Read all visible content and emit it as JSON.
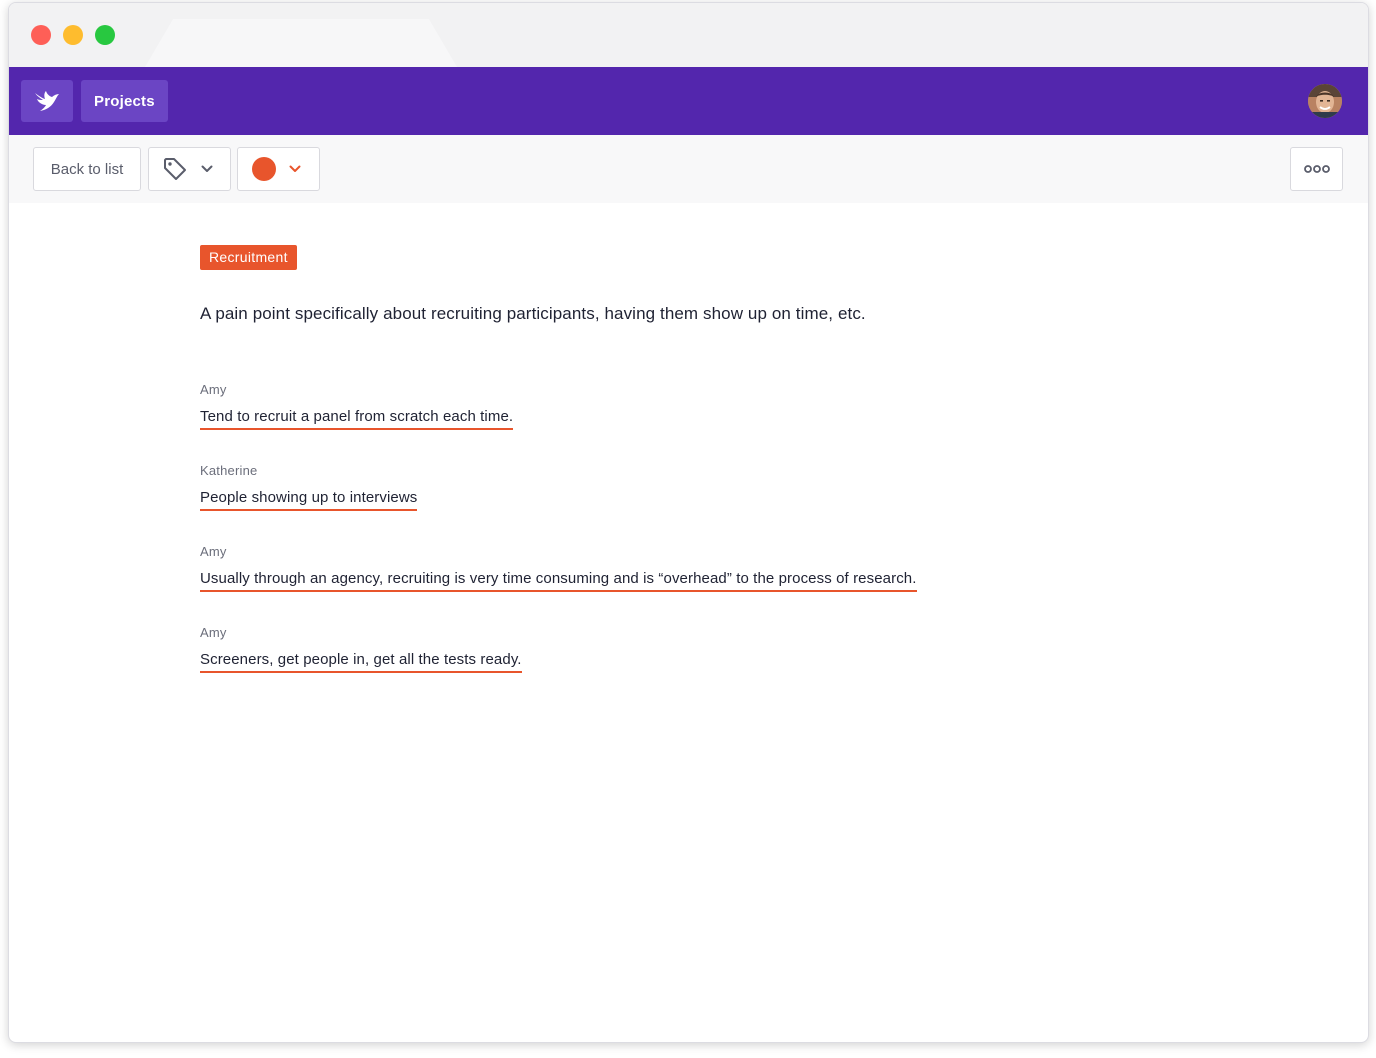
{
  "window": {
    "traffic_lights": [
      "close",
      "minimize",
      "maximize"
    ]
  },
  "appbar": {
    "logo_icon": "bird-logo-icon",
    "projects_label": "Projects",
    "avatar_icon": "user-avatar"
  },
  "toolbar": {
    "back_label": "Back to list",
    "tag_icon": "tag-icon",
    "color_value": "#e8552c",
    "more_icon": "more-dots-icon"
  },
  "insight": {
    "tag": "Recruitment",
    "description": "A pain point specifically about recruiting participants, having them show up on time, etc.",
    "quotes": [
      {
        "author": "Amy",
        "text": "Tend to recruit a panel from scratch each time."
      },
      {
        "author": "Katherine",
        "text": "People showing up to interviews"
      },
      {
        "author": "Amy",
        "text": "Usually through an agency, recruiting is very time consuming and is “overhead” to the process of research."
      },
      {
        "author": "Amy",
        "text": "Screeners, get people in, get all the tests ready."
      }
    ]
  },
  "colors": {
    "brand": "#5326ad",
    "accent": "#e8552c"
  }
}
